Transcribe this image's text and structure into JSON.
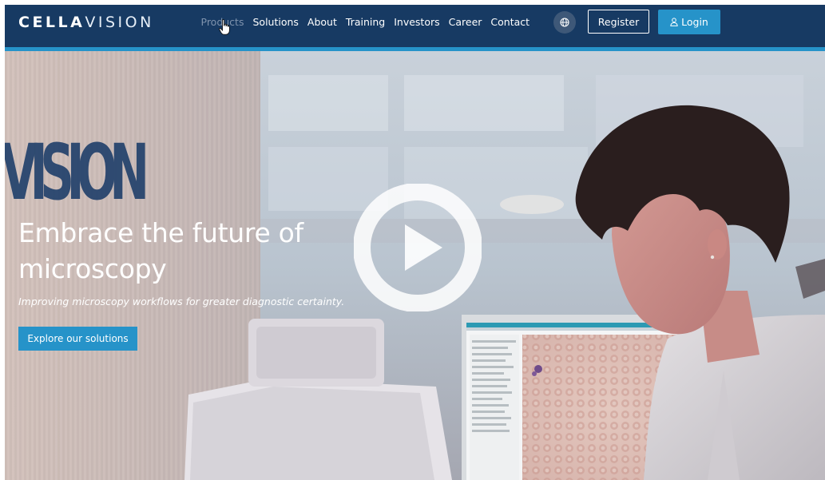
{
  "brand": {
    "logo_bold": "CELLA",
    "logo_thin": "VISION"
  },
  "nav": {
    "items": [
      {
        "label": "Products",
        "state": "hovered"
      },
      {
        "label": "Solutions"
      },
      {
        "label": "About"
      },
      {
        "label": "Training"
      },
      {
        "label": "Investors"
      },
      {
        "label": "Career"
      },
      {
        "label": "Contact"
      }
    ],
    "globe_icon": "globe-icon",
    "register_label": "Register",
    "login_label": "Login",
    "login_icon": "user-icon"
  },
  "hero": {
    "title": "Embrace the future of microscopy",
    "subtitle": "Improving microscopy workflows for greater diagnostic certainty.",
    "cta_label": "Explore our solutions",
    "play_icon": "play-icon",
    "background_sign_text": "VISION"
  },
  "colors": {
    "nav_background": "#173a63",
    "accent": "#2693c9",
    "nav_dim_text": "#7f93ad"
  }
}
